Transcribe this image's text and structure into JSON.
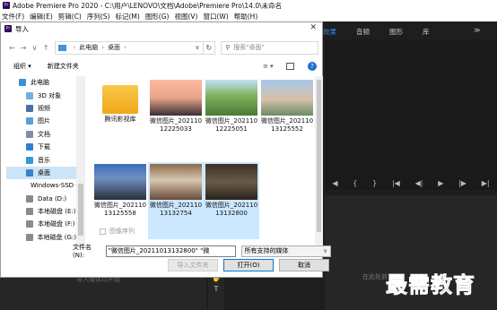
{
  "app": {
    "title": "Adobe Premiere Pro 2020 - C:\\用户\\LENOVO\\文档\\Adobe\\Premiere Pro\\14.0\\未命名",
    "logo": "Pr",
    "menu": [
      "文件(F)",
      "编辑(E)",
      "剪辑(C)",
      "序列(S)",
      "标记(M)",
      "图形(G)",
      "视图(V)",
      "窗口(W)",
      "帮助(H)"
    ],
    "panel_tabs": [
      "效果",
      "音频",
      "图形",
      "库"
    ],
    "panel_menu_icon": "≫",
    "panel_chevron": "»",
    "transport": [
      "◀",
      "{",
      "}",
      "|◀",
      "◀|",
      "▶",
      "|▶",
      "▶|"
    ],
    "lower_left_hint": "导入媒体以开始",
    "lower_right_hint": "在此处放",
    "watermark": "最需教育",
    "accent": "#2d8ceb"
  },
  "dialog": {
    "title": "导入",
    "close": "✕",
    "nav": {
      "back": "←",
      "forward": "→",
      "dropdown": "∨",
      "up": "↑"
    },
    "breadcrumb": [
      "此电脑",
      "桌面"
    ],
    "refresh": "↻",
    "search_placeholder": "搜索\"桌面\"",
    "toolbar": {
      "organize": "组织 ▾",
      "new_folder": "新建文件夹",
      "view_icon": "≡ ▾",
      "help": "?"
    },
    "nav_items": [
      {
        "label": "此电脑",
        "icon": "computer-icon",
        "color": "#3b8fd9",
        "sub": false,
        "selected": false
      },
      {
        "label": "3D 对象",
        "icon": "3d-objects-icon",
        "color": "#6fb0e6",
        "sub": true,
        "selected": false
      },
      {
        "label": "视频",
        "icon": "video-folder-icon",
        "color": "#4a6fa8",
        "sub": true,
        "selected": false
      },
      {
        "label": "图片",
        "icon": "pictures-folder-icon",
        "color": "#5aa0d8",
        "sub": true,
        "selected": false
      },
      {
        "label": "文档",
        "icon": "documents-folder-icon",
        "color": "#7f8fa6",
        "sub": true,
        "selected": false
      },
      {
        "label": "下载",
        "icon": "download-icon",
        "color": "#2f7fd0",
        "sub": true,
        "selected": false
      },
      {
        "label": "音乐",
        "icon": "music-icon",
        "color": "#2f9bd6",
        "sub": true,
        "selected": false
      },
      {
        "label": "桌面",
        "icon": "desktop-icon",
        "color": "#3b7fd0",
        "sub": true,
        "selected": true
      },
      {
        "label": "Windows-SSD (",
        "icon": "drive-icon",
        "color": "#6b6b6b",
        "sub": true,
        "selected": false
      },
      {
        "label": "Data (D:)",
        "icon": "drive-icon",
        "color": "#8a8a8a",
        "sub": true,
        "selected": false
      },
      {
        "label": "本地磁盘 (E:)",
        "icon": "drive-icon",
        "color": "#8a8a8a",
        "sub": true,
        "selected": false
      },
      {
        "label": "本地磁盘 (F:)",
        "icon": "drive-icon",
        "color": "#8a8a8a",
        "sub": true,
        "selected": false
      },
      {
        "label": "本地磁盘 (G:)",
        "icon": "drive-icon",
        "color": "#8a8a8a",
        "sub": true,
        "selected": false
      }
    ],
    "files": [
      {
        "name": "腾讯影视库",
        "thumb": "linear-gradient(#f8c84a,#f0a818)",
        "selected": false
      },
      {
        "name": "微信图片_20211012225033",
        "thumb": "linear-gradient(#ffb9a0 0%,#e8a48c 50%,#3a2f33 100%)",
        "selected": false
      },
      {
        "name": "微信图片_20211012225051",
        "thumb": "linear-gradient(#bfe2f8 0%,#7fb15c 45%,#4a7a35 100%)",
        "selected": false
      },
      {
        "name": "微信图片_20211013125552",
        "thumb": "linear-gradient(#a8c8ea 0%,#d8c0a8 55%,#6a8a68 100%)",
        "selected": false
      },
      {
        "name": "微信图片_20211013125558",
        "thumb": "linear-gradient(#3a6fb8 0%,#6f8fc0 40%,#2a2f3a 100%)",
        "selected": false
      },
      {
        "name": "微信图片_20211013132754",
        "thumb": "linear-gradient(#8a6a4a 0%,#d8c8b0 45%,#6a4a3a 100%)",
        "selected": true
      },
      {
        "name": "微信图片_20211013132800",
        "thumb": "linear-gradient(#3a3128 0%,#6a5a48 50%,#2a221a 100%)",
        "selected": true
      }
    ],
    "sequence_label": "图像序列",
    "filename_label": "文件名(N):",
    "filename_value": "\"微信图片_20211013132800\" \"微",
    "filetype_value": "所有支持的媒体",
    "buttons": {
      "import_folder": "导入文件夹",
      "open": "打开(O)",
      "cancel": "取消"
    }
  }
}
